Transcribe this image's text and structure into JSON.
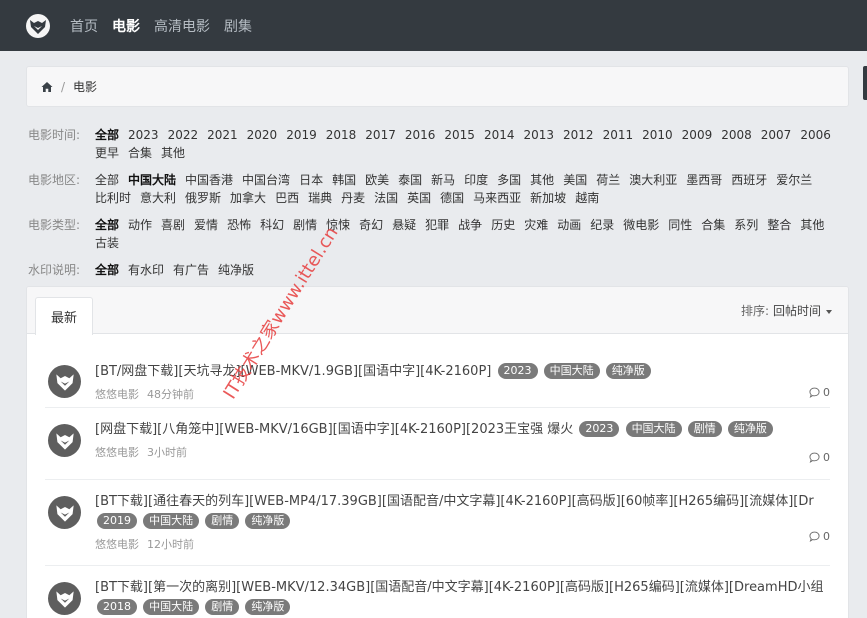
{
  "nav": {
    "items": [
      {
        "label": "首页",
        "active": false
      },
      {
        "label": "电影",
        "active": true
      },
      {
        "label": "高清电影",
        "active": false
      },
      {
        "label": "剧集",
        "active": false
      }
    ]
  },
  "breadcrumb": {
    "current": "电影",
    "separator": "/"
  },
  "filters": [
    {
      "label": "电影时间:",
      "options": [
        "全部",
        "2023",
        "2022",
        "2021",
        "2020",
        "2019",
        "2018",
        "2017",
        "2016",
        "2015",
        "2014",
        "2013",
        "2012",
        "2011",
        "2010",
        "2009",
        "2008",
        "2007",
        "2006",
        "更早",
        "合集",
        "其他"
      ],
      "active": 0
    },
    {
      "label": "电影地区:",
      "options": [
        "全部",
        "中国大陆",
        "中国香港",
        "中国台湾",
        "日本",
        "韩国",
        "欧美",
        "泰国",
        "新马",
        "印度",
        "多国",
        "其他",
        "美国",
        "荷兰",
        "澳大利亚",
        "墨西哥",
        "西班牙",
        "爱尔兰",
        "比利时",
        "意大利",
        "俄罗斯",
        "加拿大",
        "巴西",
        "瑞典",
        "丹麦",
        "法国",
        "英国",
        "德国",
        "马来西亚",
        "新加坡",
        "越南"
      ],
      "active": 1
    },
    {
      "label": "电影类型:",
      "options": [
        "全部",
        "动作",
        "喜剧",
        "爱情",
        "恐怖",
        "科幻",
        "剧情",
        "惊悚",
        "奇幻",
        "悬疑",
        "犯罪",
        "战争",
        "历史",
        "灾难",
        "动画",
        "纪录",
        "微电影",
        "同性",
        "合集",
        "系列",
        "整合",
        "其他",
        "古装"
      ],
      "active": 0
    },
    {
      "label": "水印说明:",
      "options": [
        "全部",
        "有水印",
        "有广告",
        "纯净版"
      ],
      "active": 0
    }
  ],
  "list": {
    "tab_label": "最新",
    "sort_label": "排序:",
    "sort_value": "回帖时间"
  },
  "posts": [
    {
      "title": "[BT/网盘下载][天坑寻龙][WEB-MKV/1.9GB][国语中字][4K-2160P]",
      "tags": [
        "2023",
        "中国大陆",
        "纯净版"
      ],
      "author": "悠悠电影",
      "time": "48分钟前",
      "replies": "0"
    },
    {
      "title": "[网盘下载][八角笼中][WEB-MKV/16GB][国语中字][4K-2160P][2023王宝强 爆火",
      "tags": [
        "2023",
        "中国大陆",
        "剧情",
        "纯净版"
      ],
      "author": "悠悠电影",
      "time": "3小时前",
      "replies": "0"
    },
    {
      "title": "[BT下载][通往春天的列车][WEB-MP4/17.39GB][国语配音/中文字幕][4K-2160P][高码版][60帧率][H265编码][流媒体][Dr",
      "tags": [
        "2019",
        "中国大陆",
        "剧情",
        "纯净版"
      ],
      "author": "悠悠电影",
      "time": "12小时前",
      "replies": "0"
    },
    {
      "title": "[BT下载][第一次的离别][WEB-MKV/12.34GB][国语配音/中文字幕][4K-2160P][高码版][H265编码][流媒体][DreamHD小组",
      "tags": [
        "2018",
        "中国大陆",
        "剧情",
        "纯净版"
      ],
      "author": "",
      "time": "",
      "replies": ""
    }
  ],
  "watermark": "IT技术之家www.ittel.cn",
  "colors": {
    "nav_bg": "#343a40",
    "tag_bg": "#7a7a7a",
    "watermark": "#e63c3c"
  }
}
